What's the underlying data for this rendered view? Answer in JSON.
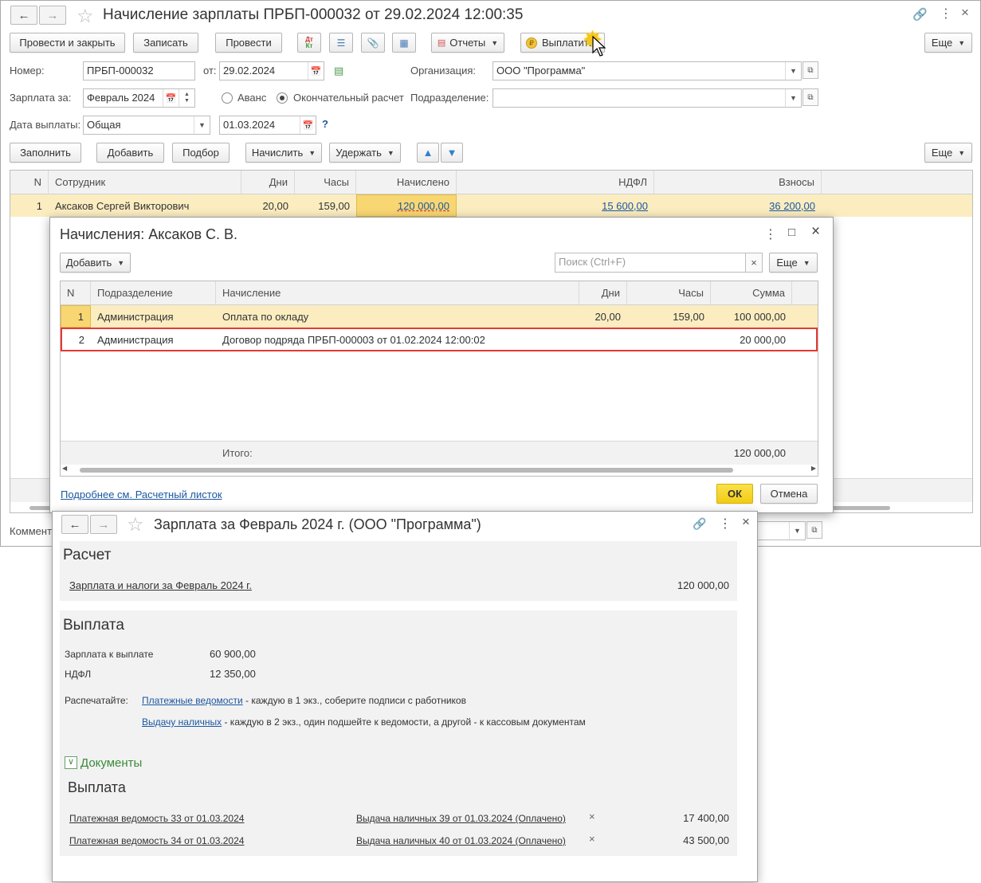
{
  "main": {
    "title": "Начисление зарплаты ПРБП-000032 от 29.02.2024 12:00:35",
    "toolbar": {
      "post_close": "Провести и закрыть",
      "save": "Записать",
      "post": "Провести",
      "dt_kt": "Дт Кт",
      "reports": "Отчеты",
      "pay": "Выплатить",
      "more": "Еще"
    },
    "form": {
      "number_label": "Номер:",
      "number_value": "ПРБП-000032",
      "date_label": "от:",
      "date_value": "29.02.2024",
      "org_label": "Организация:",
      "org_value": "ООО \"Программа\"",
      "salary_for_label": "Зарплата за:",
      "salary_for_value": "Февраль 2024",
      "advance_label": "Аванс",
      "final_label": "Окончательный расчет",
      "division_label": "Подразделение:",
      "division_value": "",
      "pay_date_label": "Дата выплаты:",
      "pay_date_kind": "Общая",
      "pay_date_value": "01.03.2024",
      "help": "?",
      "comment_label": "Коммента"
    },
    "table_toolbar": {
      "fill": "Заполнить",
      "add": "Добавить",
      "select": "Подбор",
      "accrue": "Начислить",
      "withhold": "Удержать",
      "more": "Еще"
    },
    "table": {
      "columns": [
        "N",
        "Сотрудник",
        "Дни",
        "Часы",
        "Начислено",
        "НДФЛ",
        "Взносы"
      ],
      "rows": [
        {
          "n": "1",
          "employee": "Аксаков Сергей Викторович",
          "days": "20,00",
          "hours": "159,00",
          "accrued": "120 000,00",
          "ndfl": "15 600,00",
          "contrib": "36 200,00"
        }
      ]
    }
  },
  "dialog": {
    "title": "Начисления: Аксаков С. В.",
    "add": "Добавить",
    "search_placeholder": "Поиск (Ctrl+F)",
    "search_clear": "×",
    "more": "Еще",
    "columns": [
      "N",
      "Подразделение",
      "Начисление",
      "Дни",
      "Часы",
      "Сумма"
    ],
    "rows": [
      {
        "n": "1",
        "division": "Администрация",
        "accrual": "Оплата по окладу",
        "days": "20,00",
        "hours": "159,00",
        "sum": "100 000,00"
      },
      {
        "n": "2",
        "division": "Администрация",
        "accrual": "Договор подряда ПРБП-000003 от 01.02.2024 12:00:02",
        "days": "",
        "hours": "",
        "sum": "20 000,00"
      }
    ],
    "total_label": "Итого:",
    "total_value": "120 000,00",
    "more_link": "Подробнее см. Расчетный листок",
    "ok": "ОК",
    "cancel": "Отмена"
  },
  "summary": {
    "title": "Зарплата за Февраль 2024 г. (ООО \"Программа\")",
    "calc_heading": "Расчет",
    "calc_link": "Зарплата и налоги за Февраль 2024 г.",
    "calc_value": "120 000,00",
    "pay_heading": "Выплата",
    "to_pay_label": "Зарплата к выплате",
    "to_pay_value": "60 900,00",
    "ndfl_label": "НДФЛ",
    "ndfl_value": "12 350,00",
    "print_label": "Распечатайте:",
    "print_link1": "Платежные ведомости",
    "print_text1": " - каждую в 1 экз., соберите подписи с работников",
    "print_link2": "Выдачу наличных",
    "print_text2": " - каждую в 2 экз., один подшейте к ведомости, а другой - к кассовым документам",
    "docs_toggle": "Документы",
    "docs_heading": "Выплата",
    "docs": [
      {
        "statement": "Платежная ведомость 33 от 01.03.2024",
        "cash": "Выдача наличных 39 от 01.03.2024 (Оплачено)",
        "amount": "17 400,00"
      },
      {
        "statement": "Платежная ведомость 34 от 01.03.2024",
        "cash": "Выдача наличных 40 от 01.03.2024 (Оплачено)",
        "amount": "43 500,00"
      }
    ]
  },
  "colors": {
    "selected_row": "#fbedc0",
    "accent_ok": "#f7d51e",
    "link": "#1d58a0",
    "highlight_border": "#e53935"
  }
}
